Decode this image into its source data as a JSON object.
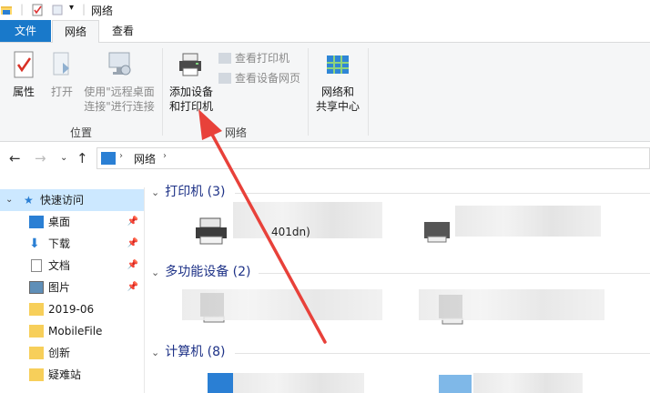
{
  "window": {
    "title": "网络"
  },
  "tabs": [
    {
      "label": "文件"
    },
    {
      "label": "网络"
    },
    {
      "label": "查看"
    }
  ],
  "ribbon": {
    "location_group": {
      "label": "位置",
      "properties": "属性",
      "open": "打开",
      "remote_line1": "使用\"远程桌面",
      "remote_line2": "连接\"进行连接"
    },
    "network_group": {
      "label": "网络",
      "add_line1": "添加设备",
      "add_line2": "和打印机",
      "view_printers": "查看打印机",
      "view_device_page": "查看设备网页"
    },
    "center_group": {
      "center_line1": "网络和",
      "center_line2": "共享中心"
    }
  },
  "address": {
    "path": "网络"
  },
  "sidebar": {
    "quick_access": "快速访问",
    "items": [
      {
        "label": "桌面",
        "pinned": true
      },
      {
        "label": "下载",
        "pinned": true
      },
      {
        "label": "文档",
        "pinned": true
      },
      {
        "label": "图片",
        "pinned": true
      },
      {
        "label": "2019-06",
        "pinned": false
      },
      {
        "label": "MobileFile",
        "pinned": false
      },
      {
        "label": "创新",
        "pinned": false
      },
      {
        "label": "疑难站",
        "pinned": false
      }
    ]
  },
  "content": {
    "groups": [
      {
        "title": "打印机 (3)"
      },
      {
        "title": "多功能设备 (2)"
      },
      {
        "title": "计算机 (8)"
      }
    ],
    "printer_partial_label": "401dn)"
  },
  "colors": {
    "accent": "#1979ca",
    "group_title": "#1e3287",
    "annotation_arrow": "#e8413a"
  }
}
